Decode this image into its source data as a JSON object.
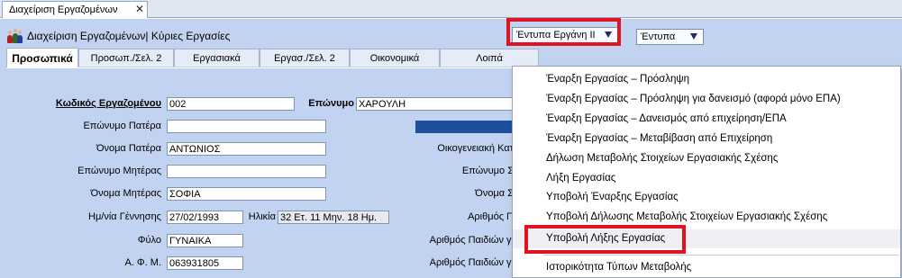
{
  "window": {
    "tab_title": "Διαχείριση Εργαζομένων",
    "tab_close": "✕"
  },
  "header": {
    "title": "Διαχείριση Εργαζομένων| Κύριες Εργασίες",
    "icon": "people-icon"
  },
  "toolbar": {
    "ergani_dropdown": "Έντυπα Εργάνη ΙΙ",
    "entypa_dropdown": "Έντυπα"
  },
  "tabs": [
    {
      "label": "Προσωπικά"
    },
    {
      "label": "Προσωπ./Σελ. 2"
    },
    {
      "label": "Εργασιακά"
    },
    {
      "label": "Εργασ./Σελ. 2"
    },
    {
      "label": "Οικονομικά"
    },
    {
      "label": "Λοιπά"
    }
  ],
  "form": {
    "employee_code_label": "Κωδικός Εργαζομένου",
    "employee_code": "002",
    "surname_label": "Επώνυμο",
    "surname": "ΧΑΡΟΥΛΗ",
    "father_surname_label": "Επώνυμο Πατέρα",
    "father_surname": "",
    "father_name_label": "Όνομα Πατέρα",
    "father_name": "ΑΝΤΩΝΙΟΣ",
    "mother_surname_label": "Επώνυμο Μητέρας",
    "mother_surname": "",
    "mother_name_label": "Όνομα Μητέρας",
    "mother_name": "ΣΟΦΙΑ",
    "birth_date_label": "Ημ/νία Γέννησης",
    "birth_date": "27/02/1993",
    "age_label": "Ηλικία",
    "age": "32 Ετ. 11 Μην. 18 Ημ.",
    "sex_label": "Φύλο",
    "sex": "ΓΥΝΑΙΚΑ",
    "afm_label": "Α. Φ. Μ.",
    "afm": "063931805",
    "right_labels": {
      "family_status": "Οικογενειακή Κατ",
      "spouse_surname": "Επώνυμο Σ",
      "spouse_name": "Όνομα Σ",
      "number": "Αριθμός Π",
      "children_1": "Αριθμός Παιδιών γι",
      "children_2": "Αριθμός Παιδιών γι"
    }
  },
  "menu": {
    "items": [
      "Έναρξη Εργασίας – Πρόσληψη",
      "Έναρξη Εργασίας – Πρόσληψη για δανεισμό (αφορά μόνο ΕΠΑ)",
      "Έναρξη Εργασίας – Δανεισμός από επιχείρηση/ΕΠΑ",
      "Έναρξη Εργασίας – Μεταβίβαση από Επιχείρηση",
      "Δήλωση Μεταβολής Στοιχείων Εργασιακής Σχέσης",
      "Λήξη Εργασίας",
      "Υποβολή Έναρξης Εργασίας",
      "Υποβολή Δήλωσης Μεταβολής Στοιχείων Εργασιακής Σχέσης",
      "Υποβολή Λήξης Εργασίας",
      "Ιστορικότητα Τύπων Μεταβολής"
    ]
  },
  "colors": {
    "highlight": "#e0141e",
    "background": "#c1d3f0",
    "accent_bar": "#1f4e9b"
  }
}
